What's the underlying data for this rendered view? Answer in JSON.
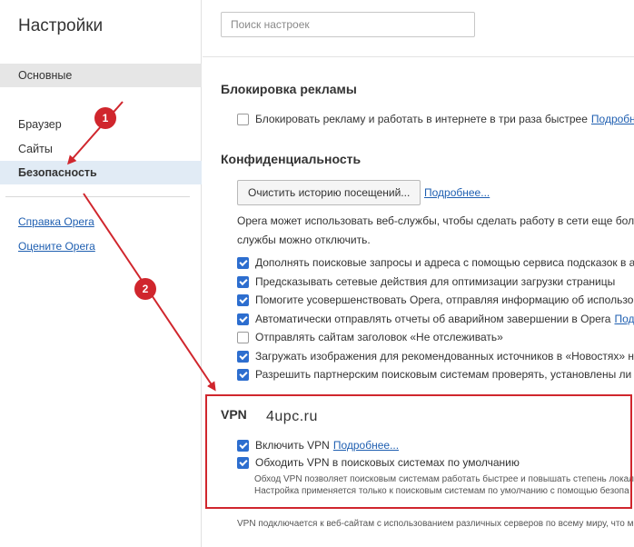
{
  "sidebar": {
    "title": "Настройки",
    "items": [
      {
        "label": "Основные"
      },
      {
        "label": "Браузер"
      },
      {
        "label": "Сайты"
      },
      {
        "label": "Безопасность"
      }
    ],
    "links": [
      {
        "label": "Справка Opera"
      },
      {
        "label": "Оцените Opera"
      }
    ]
  },
  "search": {
    "placeholder": "Поиск настроек"
  },
  "ad_block": {
    "title": "Блокировка рекламы",
    "option": {
      "label": "Блокировать рекламу и работать в интернете в три раза быстрее",
      "link": "Подробнее",
      "checked": false
    }
  },
  "privacy": {
    "title": "Конфиденциальность",
    "clear_button": "Очистить историю посещений...",
    "more_link": "Подробнее...",
    "description_line1": "Opera может использовать веб-службы, чтобы сделать работу в сети еще боле",
    "description_line2": "службы можно отключить.",
    "options": [
      {
        "label": "Дополнять поисковые запросы и адреса с помощью сервиса подсказок в ад",
        "checked": true
      },
      {
        "label": "Предсказывать сетевые действия для оптимизации загрузки страницы",
        "checked": true
      },
      {
        "label": "Помогите усовершенствовать Opera, отправляя информацию об использов",
        "checked": true
      },
      {
        "label": "Автоматически отправлять отчеты об аварийном завершении в Opera",
        "link": "Подр",
        "checked": true
      },
      {
        "label": "Отправлять сайтам заголовок «Не отслеживать»",
        "checked": false
      },
      {
        "label": "Загружать изображения для рекомендованных источников в «Новостях» на",
        "checked": true
      },
      {
        "label": "Разрешить партнерским поисковым системам проверять, установлены ли с",
        "checked": true
      }
    ]
  },
  "vpn": {
    "title": "VPN",
    "enable": {
      "label": "Включить VPN",
      "link": "Подробнее...",
      "checked": true
    },
    "bypass": {
      "label": "Обходить VPN в поисковых системах по умолчанию",
      "checked": true
    },
    "note_line1": "Обход VPN позволяет поисковым системам работать быстрее и повышать степень локали",
    "note_line2": "Настройка применяется только к поисковым системам по умолчанию с помощью безопа",
    "footer": "VPN подключается к веб-сайтам с использованием различных серверов по всему миру, что м"
  },
  "watermark": "4upc.ru",
  "annotations": [
    {
      "label": "1"
    },
    {
      "label": "2"
    }
  ],
  "colors": {
    "accent": "#2d6ecf",
    "link": "#1f5fb1",
    "annotation": "#d0262d",
    "selected_nav": "#e1ebf5"
  }
}
